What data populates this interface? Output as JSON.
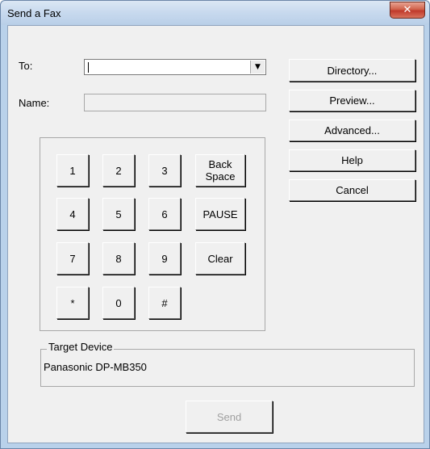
{
  "window": {
    "title": "Send a Fax",
    "close_glyph": "✕"
  },
  "form": {
    "to_label": "To:",
    "to_value": "",
    "dropdown_glyph": "▼",
    "name_label": "Name:",
    "name_value": ""
  },
  "side_buttons": {
    "directory": "Directory...",
    "preview": "Preview...",
    "advanced": "Advanced...",
    "help": "Help",
    "cancel": "Cancel"
  },
  "keypad": {
    "k1": "1",
    "k2": "2",
    "k3": "3",
    "k4": "4",
    "k5": "5",
    "k6": "6",
    "k7": "7",
    "k8": "8",
    "k9": "9",
    "star": "*",
    "k0": "0",
    "hash": "#",
    "backspace_line1": "Back",
    "backspace_line2": "Space",
    "pause": "PAUSE",
    "clear": "Clear"
  },
  "target": {
    "group_label": "Target Device",
    "device_name": "Panasonic DP-MB350"
  },
  "send_button": {
    "label": "Send",
    "enabled": false
  }
}
